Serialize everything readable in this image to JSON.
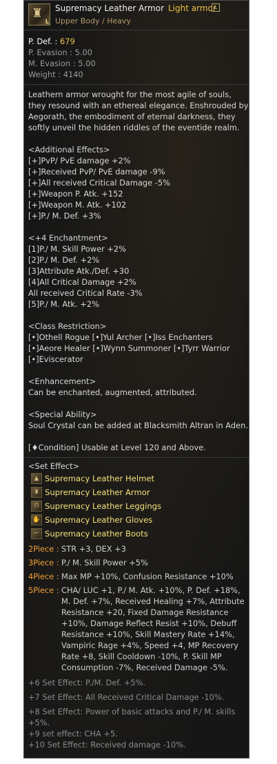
{
  "item": {
    "name": "Supremacy Leather Armor",
    "type": "Light armor",
    "grade_badge": "L",
    "icon_tag": "L",
    "slot": "Upper Body / Heavy"
  },
  "stats": {
    "pdef_label": "P. Def. : ",
    "pdef_value": "679",
    "evasion_p": "P. Evasion : 5.00",
    "evasion_m": "M. Evasion : 5.00",
    "weight": "Weight : 4140"
  },
  "description": [
    "Leathern armor wrought for the most agile of souls,",
    "they resound with an ethereal elegance. Enshrouded by",
    "Aegorath, the embodiment of eternal darkness, they",
    "softly unveil the hidden riddles of the eventide realm."
  ],
  "additional_effects": {
    "header": "<Additional Effects>",
    "lines": [
      "[+]PvP/ PvE damage +2%",
      "[+]Received PvP/ PvE damage -9%",
      "[+]All received Critical Damage -5%",
      "[+]Weapon P. Atk. +152",
      "[+]Weapon M. Atk. +102",
      "[+]P./ M. Def. +3%"
    ]
  },
  "enchantment": {
    "header": "<+4 Enchantment>",
    "lines": [
      "[1]P./ M. Skill Power +2%",
      "[2]P./ M. Def. +2%",
      "[3]Attribute Atk./Def. +30",
      "[4]All Critical Damage +2%",
      "All received Critical Rate -3%",
      "[5]P./ M. Atk. +2%"
    ]
  },
  "class_restriction": {
    "header": "<Class Restriction>",
    "lines": [
      "[•]Othell Rogue [•]Yul Archer [•]Iss Enchanters",
      "[•]Aeore Healer [•]Wynn Summoner [•]Tyrr Warrior",
      "[•]Eviscerator"
    ]
  },
  "enhancement": {
    "header": "<Enhancement>",
    "text": "Can be enchanted, augmented, attributed."
  },
  "special_ability": {
    "header": "<Special Ability>",
    "text": "Soul Crystal can be added at Blacksmith Altran in Aden."
  },
  "condition": "[♦Condition] Usable at Level 120 and Above.",
  "set_effect": {
    "header": "<Set Effect>",
    "items": [
      {
        "name": "Supremacy Leather Helmet",
        "icon": "helmet-icon"
      },
      {
        "name": "Supremacy Leather Armor",
        "icon": "armor-icon"
      },
      {
        "name": "Supremacy Leather Leggings",
        "icon": "leggings-icon"
      },
      {
        "name": "Supremacy Leather Gloves",
        "icon": "gloves-icon"
      },
      {
        "name": "Supremacy Leather Boots",
        "icon": "boots-icon"
      }
    ],
    "pieces": [
      {
        "label": "2Piece :",
        "lines": [
          "STR +3, DEX +3"
        ]
      },
      {
        "label": "3Piece :",
        "lines": [
          "P./ M. Skill Power +5%"
        ]
      },
      {
        "label": "4Piece :",
        "lines": [
          "Max MP +10%, Confusion Resistance +10%"
        ]
      },
      {
        "label": "5Piece :",
        "lines": [
          "CHA/ LUC +1, P./ M. Atk. +10%, P. Def. +18%,",
          "M. Def. +7%, Received Healing +7%, Attribute",
          "Resistance +20, Fixed Damage Resistance",
          "+10%, Damage Reflect Resist +10%, Debuff",
          "Resistance +10%, Skill Mastery Rate +14%,",
          "Vampiric Rage +4%, Speed +4, MP Recovery",
          "Rate +8, Skill Cooldown -10%, P. Skill MP",
          "Consumption -7%, Received Damage -5%."
        ]
      }
    ],
    "extra": [
      "+6 Set Effect: P./M. Def. +5%.",
      "+7 Set Effect: All Received Critical Damage -10%.",
      "+8 Set Effect: Power of basic attacks and P./ M. skills",
      "+5%.",
      "+9 set effect: CHA +5.",
      "+10 Set Effect: Received damage -10%."
    ]
  },
  "colors": {
    "title": "#f0f0f0",
    "armor_type": "#e8c24a",
    "set_item": "#f4e07a",
    "piece_label": "#f0a037",
    "pdef_value": "#f2c64d"
  }
}
